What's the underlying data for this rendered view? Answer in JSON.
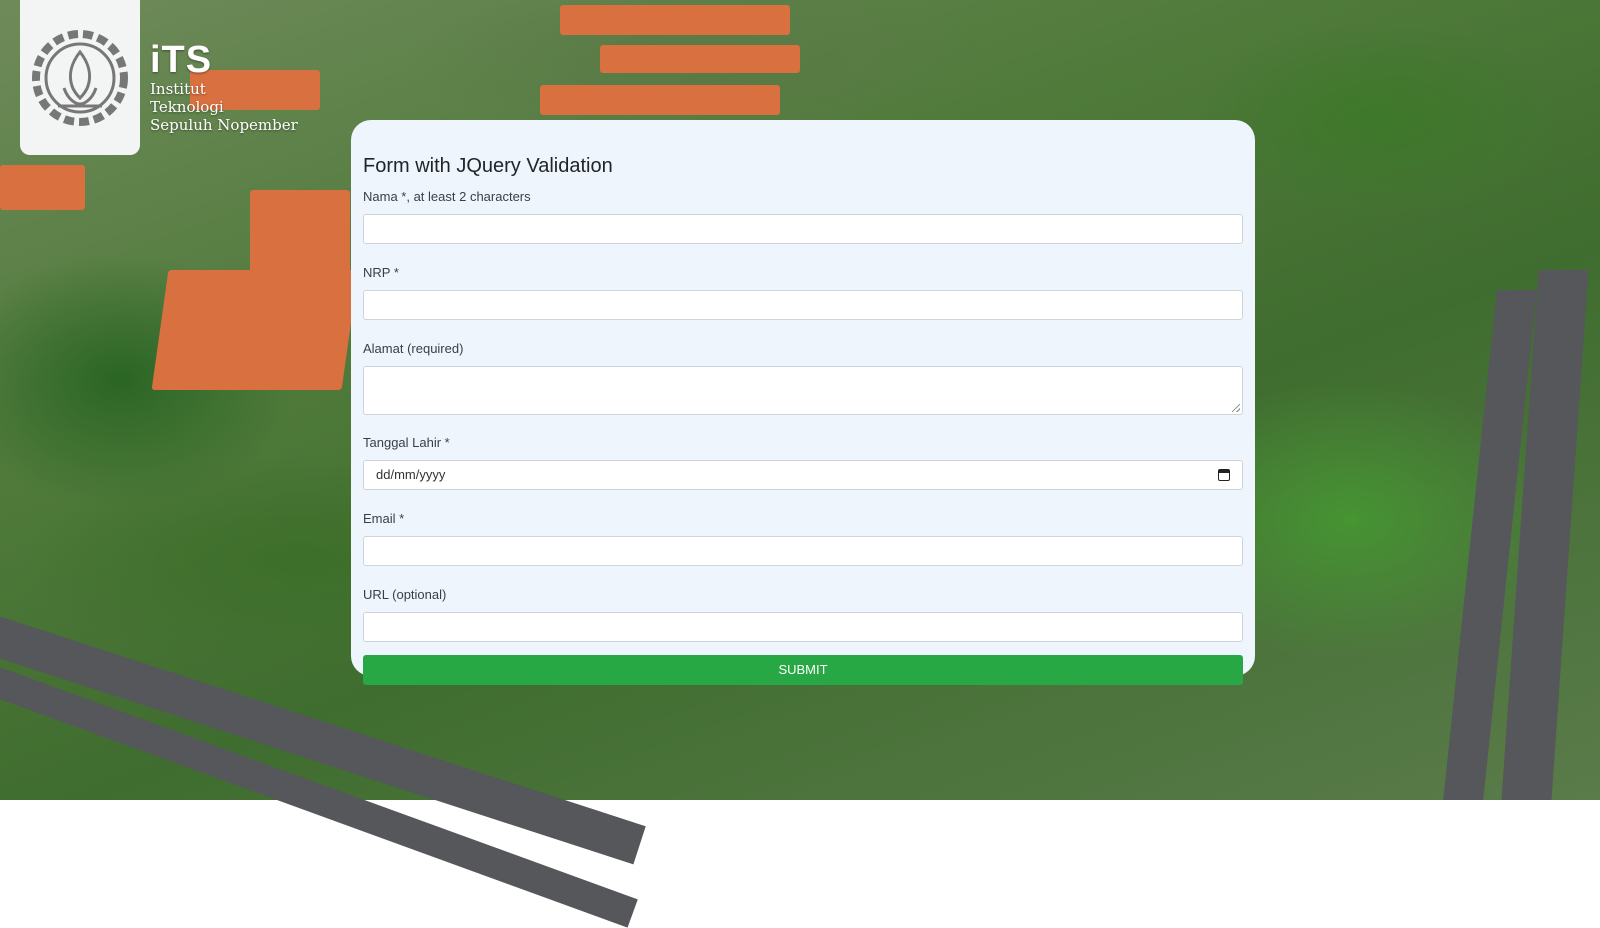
{
  "branding": {
    "acronym": "iTS",
    "lines": [
      "Institut",
      "Teknologi",
      "Sepuluh Nopember"
    ]
  },
  "form": {
    "title": "Form with JQuery Validation",
    "fields": [
      {
        "label": "Nama *, at least 2 characters",
        "value": "",
        "placeholder": ""
      },
      {
        "label": "NRP *",
        "value": "",
        "placeholder": ""
      },
      {
        "label": "Alamat (required)",
        "value": "",
        "placeholder": ""
      },
      {
        "label": "Tanggal Lahir *",
        "value": "",
        "placeholder": "dd/mm/yyyy"
      },
      {
        "label": "Email *",
        "value": "",
        "placeholder": ""
      },
      {
        "label": "URL (optional)",
        "value": "",
        "placeholder": ""
      }
    ],
    "submit_label": "SUBMIT"
  },
  "colors": {
    "card_background": "#eef5fd",
    "submit_button": "#28a745"
  },
  "icons": [
    "its-logo-icon",
    "calendar-icon",
    "resize-handle-icon"
  ]
}
